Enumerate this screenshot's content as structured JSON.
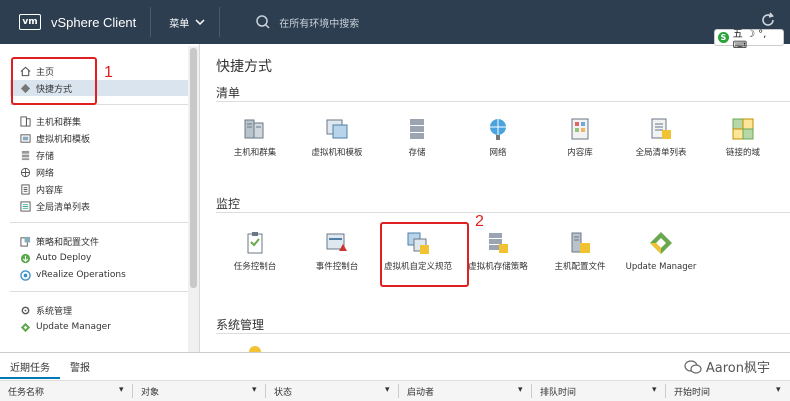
{
  "topbar": {
    "logo": "vm",
    "app_title": "vSphere Client",
    "menu_label": "菜单",
    "search_placeholder": "在所有环境中搜索"
  },
  "ime": {
    "text": "五 ☽ °, ⌨"
  },
  "sidebar": {
    "home": "主页",
    "shortcuts": "快捷方式",
    "group1": [
      "主机和群集",
      "虚拟机和模板",
      "存储",
      "网络",
      "内容库",
      "全局清单列表"
    ],
    "group2": [
      "策略和配置文件",
      "Auto Deploy",
      "vRealize Operations"
    ],
    "group3": [
      "系统管理",
      "Update Manager"
    ]
  },
  "main": {
    "title": "快捷方式",
    "inventory_title": "清单",
    "inventory_tiles": [
      "主机和群集",
      "虚拟机和模板",
      "存储",
      "网络",
      "内容库",
      "全局清单列表",
      "链接的域"
    ],
    "monitor_title": "监控",
    "monitor_tiles": [
      "任务控制台",
      "事件控制台",
      "虚拟机自定义规范",
      "虚拟机存储策略",
      "主机配置文件",
      "Update Manager"
    ],
    "admin_title": "系统管理"
  },
  "annotations": {
    "n1": "1",
    "n2": "2"
  },
  "bottom": {
    "tabs": [
      "近期任务",
      "警报"
    ],
    "columns": [
      "任务名称",
      "对象",
      "状态",
      "启动者",
      "排队时间",
      "开始时间"
    ]
  },
  "watermark": "Aaron枫宇",
  "colors": {
    "topbar": "#2d3e50",
    "selected": "#d9e4ee",
    "annotation": "#e02020",
    "accent": "#0079b8"
  }
}
